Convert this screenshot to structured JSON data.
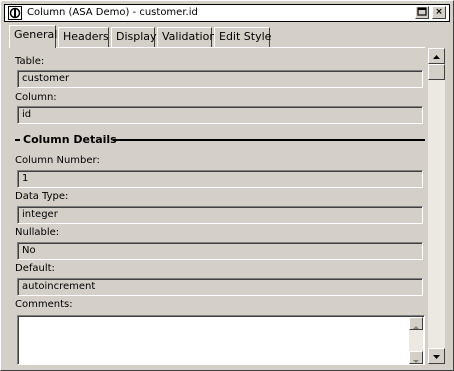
{
  "window": {
    "title": "Column (ASA Demo) - customer.id",
    "minimize_glyph": "_",
    "close_glyph": "×"
  },
  "tabs": [
    {
      "label": "General",
      "active": true
    },
    {
      "label": "Headers",
      "active": false
    },
    {
      "label": "Display",
      "active": false
    },
    {
      "label": "Validation",
      "active": false
    },
    {
      "label": "Edit Style",
      "active": false
    }
  ],
  "form": {
    "table_label": "Table:",
    "table_value": "customer",
    "column_label": "Column:",
    "column_value": "id",
    "section_title": "Column Details",
    "column_number_label": "Column Number:",
    "column_number_value": "1",
    "data_type_label": "Data Type:",
    "data_type_value": "integer",
    "nullable_label": "Nullable:",
    "nullable_value": "No",
    "default_label": "Default:",
    "default_value": "autoincrement",
    "comments_label": "Comments:",
    "comments_value": ""
  },
  "icons": {
    "app": "database-column-icon",
    "scroll_up": "arrow-up-icon",
    "scroll_down": "arrow-down-icon"
  }
}
